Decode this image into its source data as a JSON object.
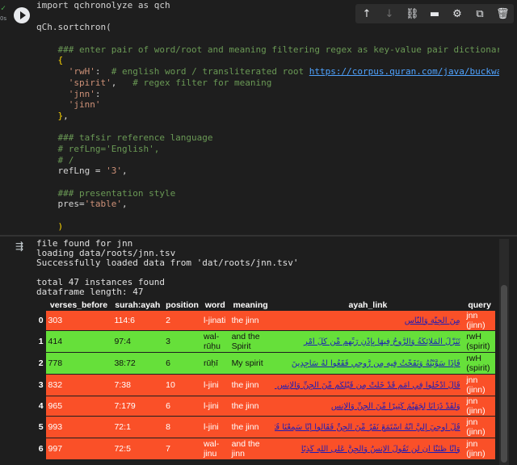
{
  "status": {
    "check": "✓",
    "time": "0s"
  },
  "code_lines": [
    {
      "parts": [
        {
          "t": "import qchronolyze as qch",
          "c": "kw"
        }
      ]
    },
    {
      "parts": []
    },
    {
      "parts": [
        {
          "t": "qCh.sortchron(",
          "c": "kw"
        }
      ]
    },
    {
      "parts": []
    },
    {
      "parts": [
        {
          "t": "    ### enter pair of word/root and meaning filtering regex as key-value pair dictionary",
          "c": "cm"
        }
      ]
    },
    {
      "parts": [
        {
          "t": "    {",
          "c": "bracket"
        }
      ]
    },
    {
      "parts": [
        {
          "t": "      'rwH'",
          "c": "st"
        },
        {
          "t": ":  ",
          "c": "kw"
        },
        {
          "t": "# english word / transliterated root ",
          "c": "cm"
        },
        {
          "t": "https://corpus.quran.com/java/buckwalter.jsp",
          "c": "link"
        }
      ]
    },
    {
      "parts": [
        {
          "t": "      'spirit'",
          "c": "st"
        },
        {
          "t": ",   ",
          "c": "kw"
        },
        {
          "t": "# regex filter for meaning",
          "c": "cm"
        }
      ]
    },
    {
      "parts": [
        {
          "t": "      'jnn'",
          "c": "st"
        },
        {
          "t": ":",
          "c": "kw"
        }
      ]
    },
    {
      "parts": [
        {
          "t": "      'jinn'",
          "c": "st"
        }
      ]
    },
    {
      "parts": [
        {
          "t": "    }",
          "c": "bracket"
        },
        {
          "t": ",",
          "c": "kw"
        }
      ]
    },
    {
      "parts": []
    },
    {
      "parts": [
        {
          "t": "    ### tafsir reference language",
          "c": "cm"
        }
      ]
    },
    {
      "parts": [
        {
          "t": "    # refLng='English',",
          "c": "cm"
        }
      ]
    },
    {
      "parts": [
        {
          "t": "    # /",
          "c": "cm"
        }
      ]
    },
    {
      "parts": [
        {
          "t": "    refLng = ",
          "c": "kw"
        },
        {
          "t": "'3'",
          "c": "st"
        },
        {
          "t": ",",
          "c": "kw"
        }
      ]
    },
    {
      "parts": []
    },
    {
      "parts": [
        {
          "t": "    ### presentation style",
          "c": "cm"
        }
      ]
    },
    {
      "parts": [
        {
          "t": "    pres=",
          "c": "kw"
        },
        {
          "t": "'table'",
          "c": "st"
        },
        {
          "t": ",",
          "c": "kw"
        }
      ]
    },
    {
      "parts": []
    },
    {
      "parts": [
        {
          "t": "    )",
          "c": "bracket"
        }
      ]
    }
  ],
  "toolbar": {
    "icons": [
      "arrow-up-icon",
      "arrow-down-icon",
      "link-icon",
      "comment-icon",
      "settings-icon",
      "mirror-cell-icon",
      "delete-icon"
    ],
    "glyphs": [
      "↑",
      "↓",
      "⛓",
      "▬",
      "⚙",
      "⧉",
      "🗑"
    ],
    "more": "⋮"
  },
  "output": {
    "icon": "⇶",
    "lines": [
      "file found for jnn",
      "loading data/roots/jnn.tsv",
      "Successfully loaded data from 'dat/roots/jnn.tsv'",
      "",
      "total 47 instances found",
      "dataframe length: 47"
    ]
  },
  "table": {
    "columns": [
      "",
      "verses_before",
      "surah:ayah",
      "position",
      "word",
      "meaning",
      "ayah_link",
      "query"
    ],
    "rows": [
      {
        "idx": "0",
        "verses_before": "303",
        "surah_ayah": "114:6",
        "position": "2",
        "word": "l-jinati",
        "meaning": "the jinn",
        "ayah_link": "مِنَ الْجِنَّةِ وَالنَّاسِ",
        "query": "jnn (jinn)",
        "color": "red"
      },
      {
        "idx": "1",
        "verses_before": "414",
        "surah_ayah": "97:4",
        "position": "3",
        "word": "wal-rūḥu",
        "meaning": "and the Spirit",
        "ayah_link": "تَنَزَّلُ الْمَلَائِكَةُ وَالرُّوحُ فِيهَا بِإِذْنِ رَبِّهِم مِّن كُلِّ أَمْرٍ",
        "query": "rwH (spirit)",
        "color": "green"
      },
      {
        "idx": "2",
        "verses_before": "778",
        "surah_ayah": "38:72",
        "position": "6",
        "word": "rūḥī",
        "meaning": "My spirit",
        "ayah_link": "فَإِذَا سَوَّيْتُهُ وَنَفَخْتُ فِيهِ مِن رُّوحِي فَقَعُوا لَهُ سَاجِدِينَ",
        "query": "rwH (spirit)",
        "color": "green"
      },
      {
        "idx": "3",
        "verses_before": "832",
        "surah_ayah": "7:38",
        "position": "10",
        "word": "l-jini",
        "meaning": "the jinn",
        "ayah_link": "قَالَ ادْخُلُوا فِي أُمَمٍ قَدْ خَلَتْ مِن قَبْلِكُم مِّنَ الْجِنِّ وَالْإِنسِ فِي النَّارِ",
        "query": "jnn (jinn)",
        "color": "red"
      },
      {
        "idx": "4",
        "verses_before": "965",
        "surah_ayah": "7:179",
        "position": "6",
        "word": "l-jini",
        "meaning": "the jinn",
        "ayah_link": "وَلَقَدْ ذَرَأْنَا لِجَهَنَّمَ كَثِيرًا مِّنَ الْجِنِّ وَالْإِنسِ",
        "query": "jnn (jinn)",
        "color": "red"
      },
      {
        "idx": "5",
        "verses_before": "993",
        "surah_ayah": "72:1",
        "position": "8",
        "word": "l-jini",
        "meaning": "the jinn",
        "ayah_link": "قُلْ أُوحِيَ إِلَيَّ أَنَّهُ اسْتَمَعَ نَفَرٌ مِّنَ الْجِنِّ فَقَالُوا إِنَّا سَمِعْنَا قُرْآنًا عَجَبًا",
        "query": "jnn (jinn)",
        "color": "red"
      },
      {
        "idx": "6",
        "verses_before": "997",
        "surah_ayah": "72:5",
        "position": "7",
        "word": "wal-jinu",
        "meaning": "and the jinn",
        "ayah_link": "وَأَنَّا ظَنَنَّا أَن لَّن تَقُولَ الْإِنسُ وَالْجِنُّ عَلَى اللَّهِ كَذِبًا",
        "query": "jnn (jinn)",
        "color": "red"
      }
    ]
  }
}
